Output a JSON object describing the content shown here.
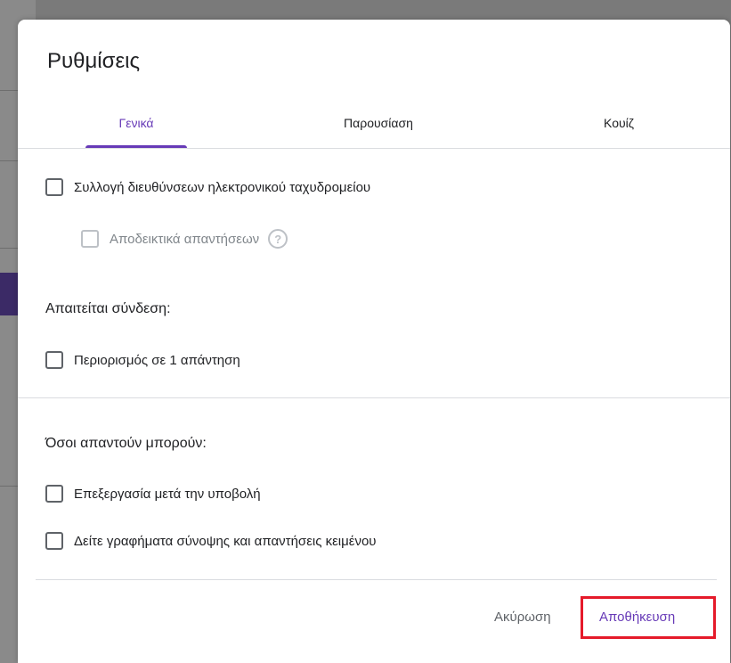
{
  "dialog": {
    "title": "Ρυθμίσεις",
    "tabs": [
      {
        "label": "Γενικά",
        "active": true
      },
      {
        "label": "Παρουσίαση",
        "active": false
      },
      {
        "label": "Κουίζ",
        "active": false
      }
    ],
    "options": {
      "collect_emails": {
        "label": "Συλλογή διευθύνσεων ηλεκτρονικού ταχυδρομείου",
        "checked": false
      },
      "response_receipts": {
        "label": "Αποδεικτικά απαντήσεων",
        "checked": false,
        "disabled": true,
        "icon": "help-icon"
      },
      "requires_signin_heading": "Απαιτείται σύνδεση:",
      "limit_one_response": {
        "label": "Περιορισμός σε 1 απάντηση",
        "checked": false
      },
      "respondents_can_heading": "Όσοι απαντούν μπορούν:",
      "edit_after_submit": {
        "label": "Επεξεργασία μετά την υποβολή",
        "checked": false
      },
      "see_summary": {
        "label": "Δείτε γραφήματα σύνοψης και απαντήσεις κειμένου",
        "checked": false
      }
    },
    "footer": {
      "cancel_label": "Ακύρωση",
      "save_label": "Αποθήκευση"
    }
  },
  "colors": {
    "accent": "#673ab7",
    "highlight": "#e51a2a"
  }
}
